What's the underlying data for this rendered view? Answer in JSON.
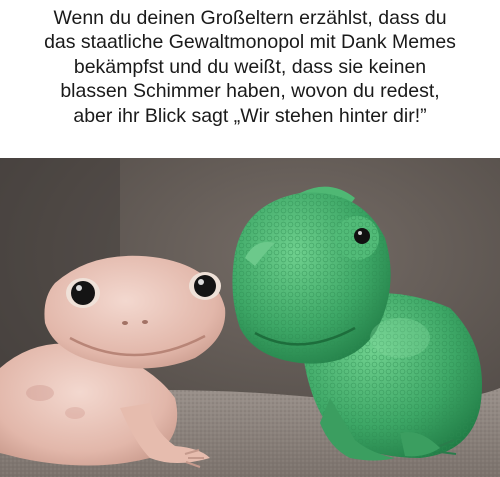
{
  "meme": {
    "caption_lines": [
      "Wenn du deinen Großeltern erzählst, dass du",
      "das staatliche Gewaltmonopol mit Dank Memes",
      "bekämpfst und du weißt, dass sie keinen",
      "blassen Schimmer haben, wovon du redest,",
      "aber ihr Blick sagt „Wir stehen hinter dir!”"
    ],
    "photo": {
      "subject_left": "leopard-gecko",
      "subject_right": "chameleon",
      "colors": {
        "background": "#5d5752",
        "carpet": "#8f8681",
        "gecko": "#e8c3b8",
        "chameleon": "#3fae6c"
      }
    }
  }
}
